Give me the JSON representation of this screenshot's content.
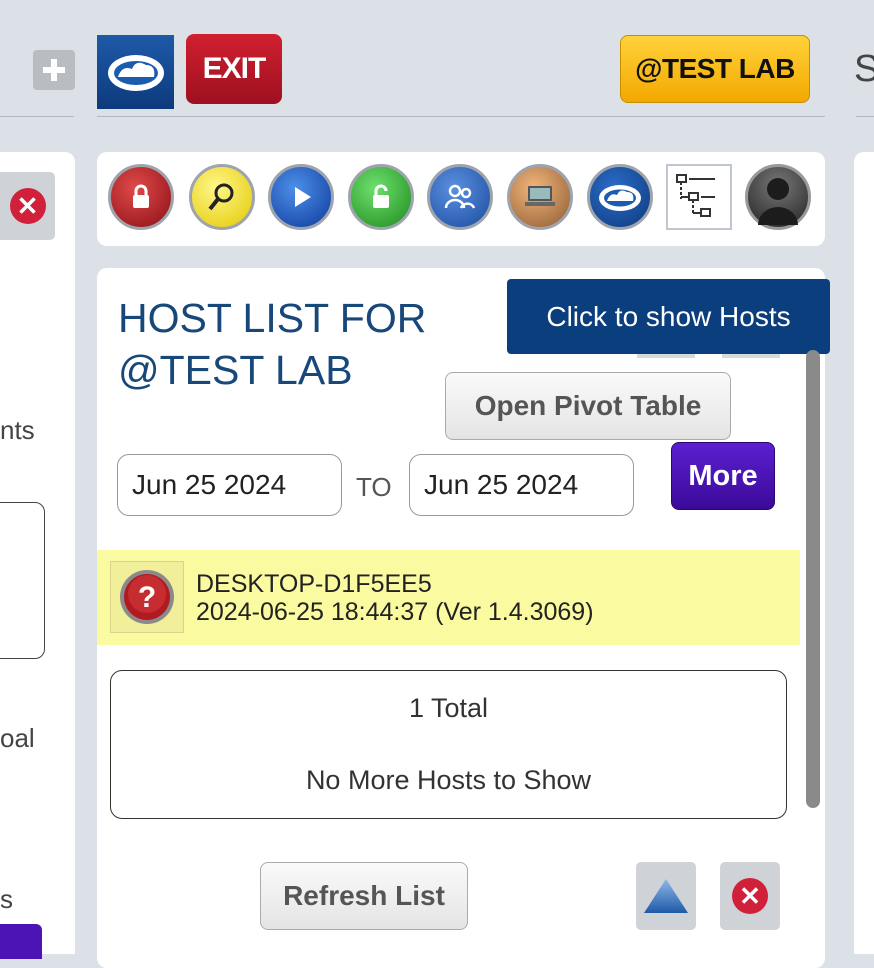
{
  "topbar": {
    "exit_label": "EXIT",
    "org_label": "@TEST LAB",
    "cut_letter": "S"
  },
  "left_panel": {
    "fragments": [
      "nts",
      "oal",
      "s"
    ]
  },
  "toolbar": {
    "icons": [
      "lock-red-icon",
      "magnifier-icon",
      "play-icon",
      "lock-green-icon",
      "users-icon",
      "computer-icon",
      "cloud-logo-icon",
      "tree-diagram-icon",
      "user-silhouette-icon"
    ]
  },
  "main": {
    "title": "HOST LIST FOR @TEST LAB",
    "tooltip": "Click to show Hosts",
    "pivot_label": "Open Pivot Table",
    "date_from": "Jun 25 2024",
    "to_label": "TO",
    "date_to": "Jun 25 2024",
    "more_label": "More",
    "host": {
      "name": "DESKTOP-D1F5EE5",
      "details": "2024-06-25 18:44:37 (Ver 1.4.3069)"
    },
    "total_text": "1 Total",
    "no_more_text": "No More Hosts to Show",
    "refresh_label": "Refresh List"
  },
  "colors": {
    "exit": "#c41a2a",
    "org": "#fbbf16",
    "title": "#18477a",
    "tooltip": "#0b3e7d",
    "more": "#4c13b5",
    "host_row": "#fafaa0"
  }
}
